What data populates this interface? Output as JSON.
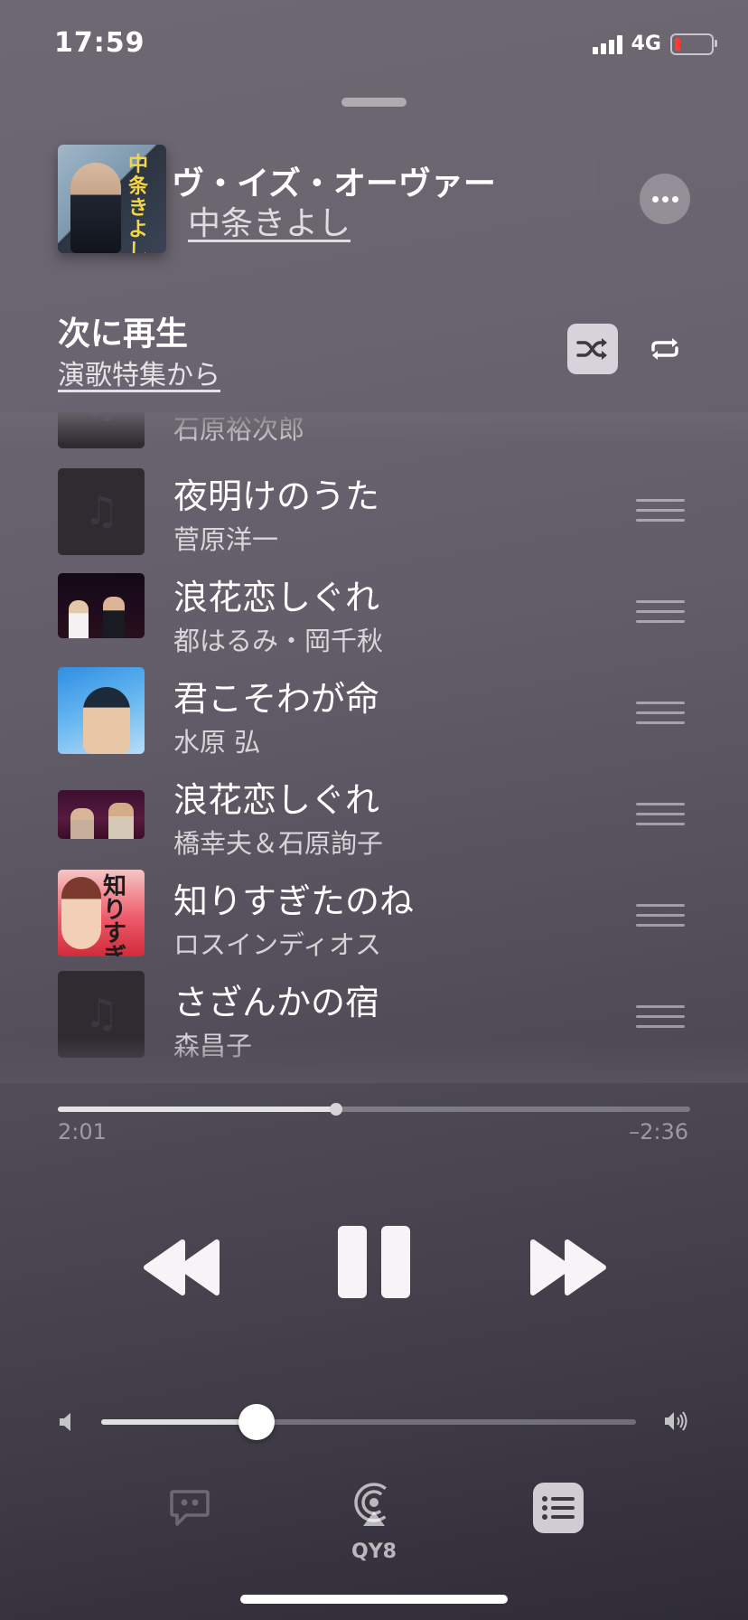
{
  "status_bar": {
    "time": "17:59",
    "network": "4G",
    "battery_color": "#ff3b30"
  },
  "now_playing": {
    "title": "ヴ・イズ・オーヴァー",
    "artist": "中条きよし",
    "art_text": "中条きよし"
  },
  "up_next": {
    "heading": "次に再生",
    "source": "演歌特集から",
    "items": [
      {
        "title": "",
        "artist": "石原裕次郎",
        "art": "placeholder"
      },
      {
        "title": "夜明けのうた",
        "artist": "菅原洋一",
        "art": "placeholder"
      },
      {
        "title": "浪花恋しぐれ",
        "artist": "都はるみ・岡千秋",
        "art": "stage"
      },
      {
        "title": "君こそわが命",
        "artist": "水原 弘",
        "art": "sky"
      },
      {
        "title": "浪花恋しぐれ",
        "artist": "橋幸夫＆石原詢子",
        "art": "duet"
      },
      {
        "title": "知りすぎたのね",
        "artist": "ロスインディオス",
        "art": "red",
        "art_text": "知りすぎ"
      },
      {
        "title": "さざんかの宿",
        "artist": "森昌子",
        "art": "placeholder"
      }
    ]
  },
  "playback": {
    "elapsed": "2:01",
    "remaining": "–2:36",
    "progress_fraction": 0.44,
    "volume_fraction": 0.29
  },
  "bottom_bar": {
    "airplay_label": "QY8"
  },
  "icons": {
    "more": "ellipsis-icon",
    "shuffle": "shuffle-icon",
    "repeat": "repeat-icon",
    "rewind": "rewind-icon",
    "pause": "pause-icon",
    "forward": "fast-forward-icon",
    "lyrics": "lyrics-icon",
    "airplay": "airplay-icon",
    "queue": "queue-list-icon"
  }
}
